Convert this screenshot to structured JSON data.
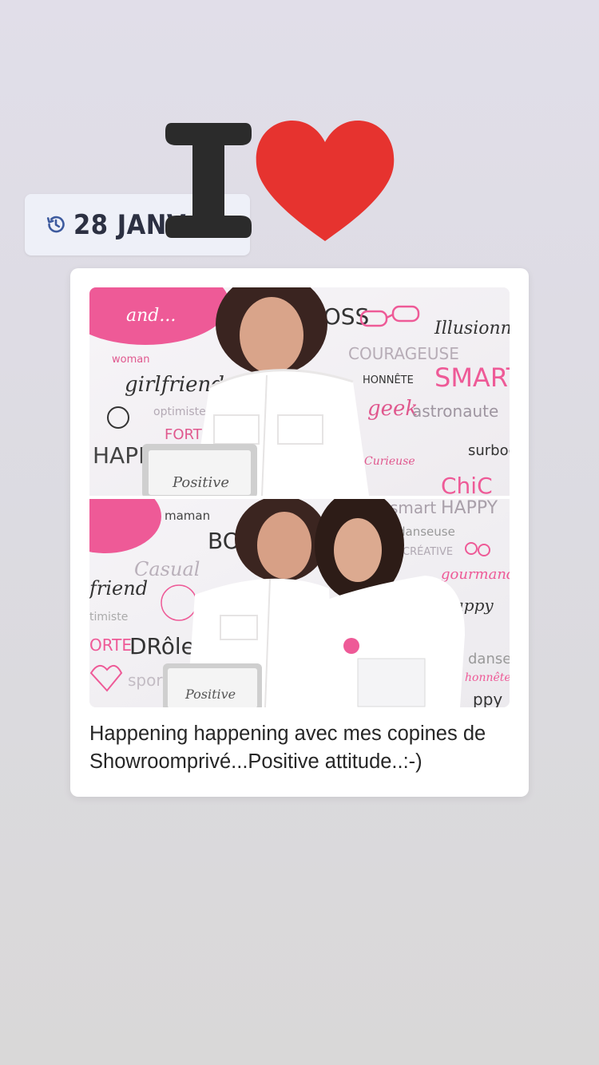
{
  "story": {
    "date_label": "28 JANV.",
    "date_icon": "history-clock-icon",
    "sticker_letter": "I",
    "sticker_heart": "heart-icon",
    "colors": {
      "heart": "#e6332f",
      "letter": "#2b2b2b",
      "text": "#262626",
      "accent_pink": "#ee5a97"
    }
  },
  "post": {
    "photo_top": {
      "sign_text": "Positive",
      "wall_words": [
        "and...",
        "woman",
        "girlfriend",
        "optimiste",
        "FORT",
        "HAPPY",
        "BOSS",
        "COURAGEUSE",
        "HONNÊTE",
        "geek",
        "SMART",
        "Illusionniste",
        "astronaute",
        "surbooké",
        "Curieuse",
        "ChiC"
      ]
    },
    "photo_bottom": {
      "sign_text": "Positive",
      "wall_words": [
        "maman",
        "BOSS",
        "Casual",
        "friend",
        "timiste",
        "ORTE",
        "DRôle",
        "sport",
        "smart",
        "HAPPY",
        "danseuse",
        "CRÉATIVE",
        "gourmande",
        "happy",
        "danseuse",
        "honnête",
        "ppy"
      ]
    },
    "caption": "Happening happening avec mes copines de Showroomprivé...Positive attitude..:-)"
  }
}
